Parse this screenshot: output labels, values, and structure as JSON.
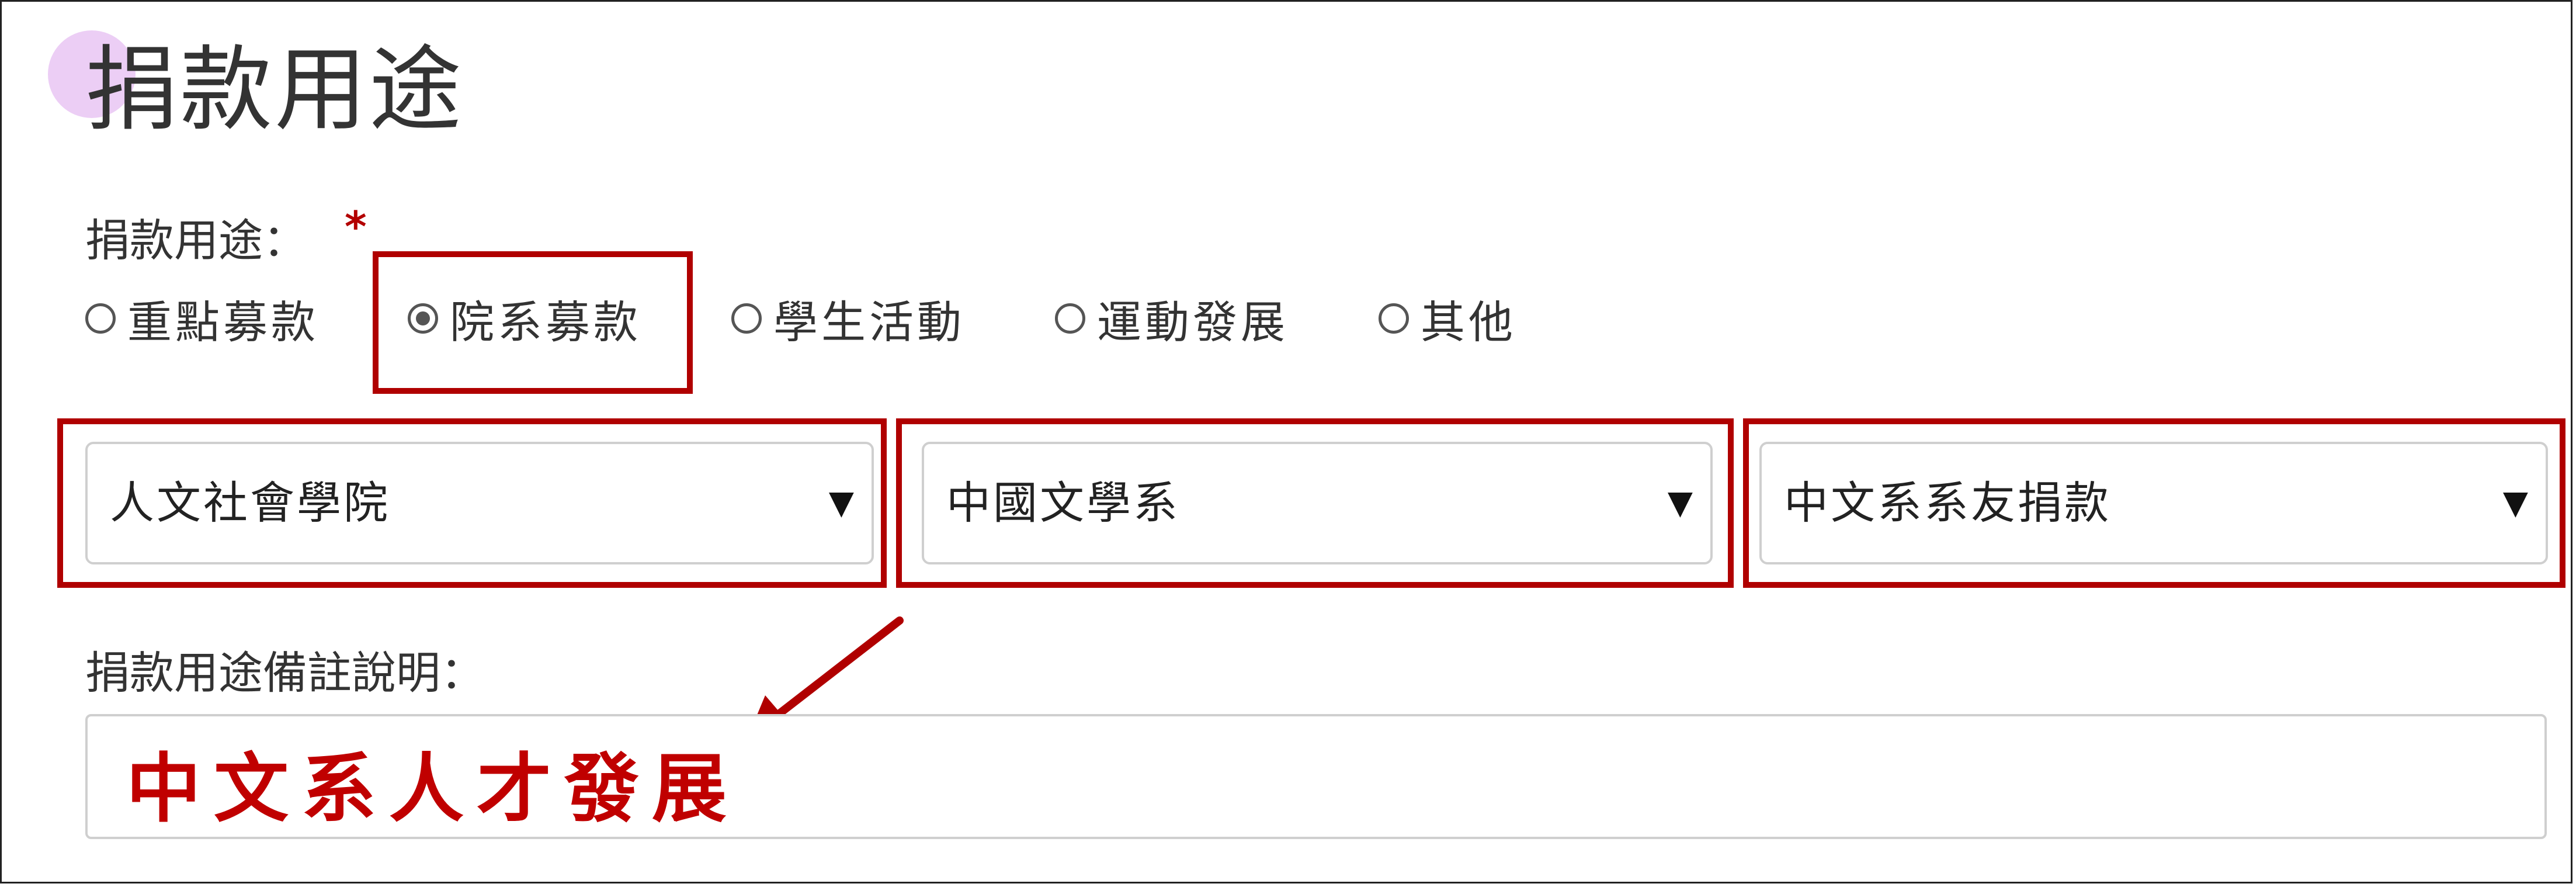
{
  "section": {
    "title": "捐款用途"
  },
  "purpose_field": {
    "label": "捐款用途：",
    "required_mark": "*",
    "options": [
      {
        "label": "重點募款",
        "checked": false
      },
      {
        "label": "院系募款",
        "checked": true
      },
      {
        "label": "學生活動",
        "checked": false
      },
      {
        "label": "運動發展",
        "checked": false
      },
      {
        "label": "其他",
        "checked": false
      }
    ]
  },
  "selects": {
    "college": {
      "value": "人文社會學院"
    },
    "department": {
      "value": "中國文學系"
    },
    "fund": {
      "value": "中文系系友捐款"
    },
    "arrow_glyph": "▼"
  },
  "remarks": {
    "label": "捐款用途備註說明：",
    "value": "中文系人才發展"
  },
  "colors": {
    "highlight": "#b00000",
    "annotation_text": "#c00000",
    "decor_circle": "#e9c5f3"
  },
  "icons": {
    "radio": "radio-circle",
    "dropdown": "triangle-down",
    "annotation": "arrow-pointing-down-left"
  }
}
